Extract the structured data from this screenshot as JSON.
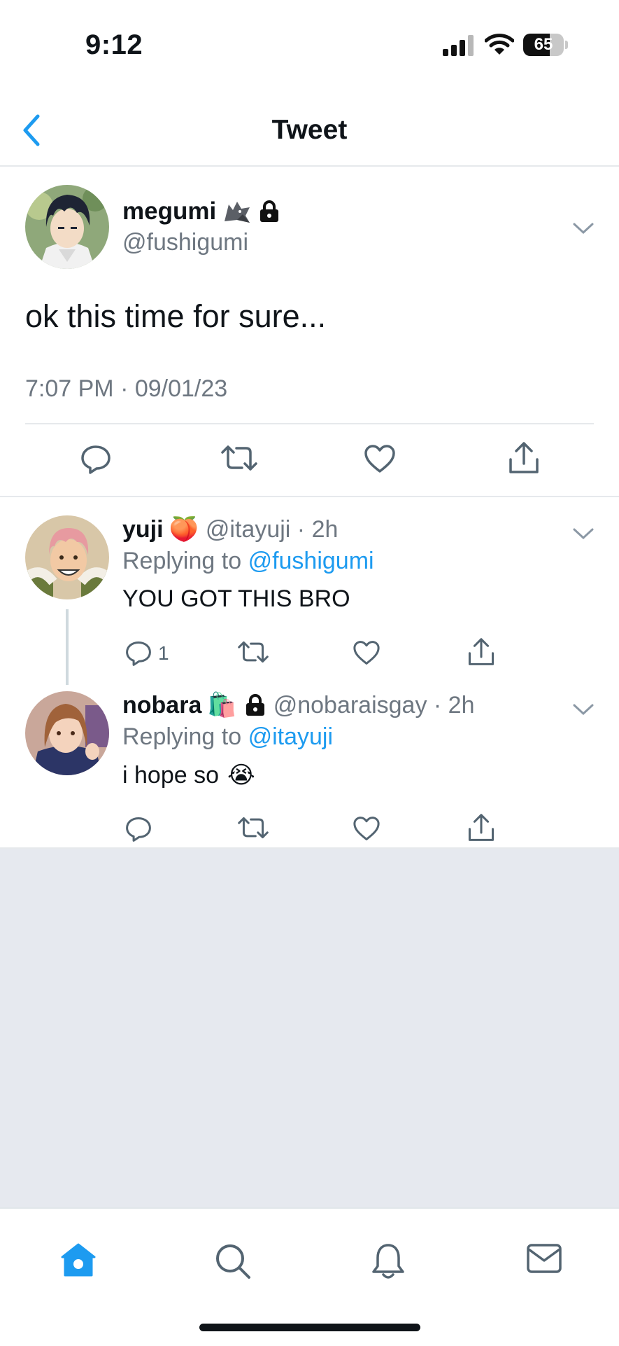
{
  "status_bar": {
    "time": "9:12",
    "battery": "65",
    "battery_level": 0.65
  },
  "nav": {
    "title": "Tweet"
  },
  "main_tweet": {
    "name": "megumi",
    "name_emojis": [
      "wolf-emoji",
      "lock-icon"
    ],
    "handle": "@fushigumi",
    "text": "ok this time for sure...",
    "timestamp": "7:07 PM · 09/01/23"
  },
  "replies": [
    {
      "name": "yuji",
      "emoji": "🍑",
      "handle": "@itayuji · 2h",
      "replying_prefix": "Replying to",
      "replying_to": "@fushigumi",
      "text": "YOU GOT THIS BRO",
      "reply_count": "1"
    },
    {
      "name": "nobara",
      "emoji": "🛍️",
      "handle": "@nobaraisgay · 2h",
      "replying_prefix": "Replying to",
      "replying_to": "@itayuji",
      "text": "i hope so",
      "text_emoji": "😭",
      "reply_count": ""
    }
  ],
  "tabbar": {
    "tabs": [
      "home",
      "search",
      "notifications",
      "messages"
    ],
    "active": "home"
  },
  "colors": {
    "accent": "#1d9bf0",
    "secondary_text": "#6e7781",
    "empty_background": "#e6e9ef"
  }
}
